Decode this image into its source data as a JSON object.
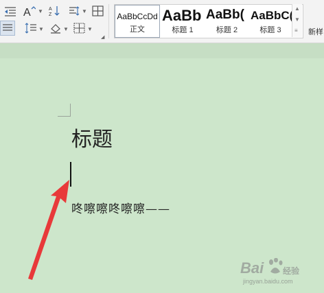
{
  "ribbon": {
    "style_gallery": [
      {
        "sample": "AaBbCcDd",
        "label": "正文",
        "selected": true
      },
      {
        "sample": "AaBb",
        "label": "标题 1",
        "selected": false
      },
      {
        "sample": "AaBb(",
        "label": "标题 2",
        "selected": false
      },
      {
        "sample": "AaBbC(",
        "label": "标题 3",
        "selected": false
      }
    ],
    "new_style_label": "新样"
  },
  "document": {
    "title": "标题",
    "body_text": "咚嚓嚓咚嚓嚓——"
  },
  "watermark": {
    "brand": "Bai",
    "sub": "经验",
    "url": "jingyan.baidu.com"
  },
  "colors": {
    "page_background": "#cde6cb",
    "arrow": "#e8393a"
  }
}
